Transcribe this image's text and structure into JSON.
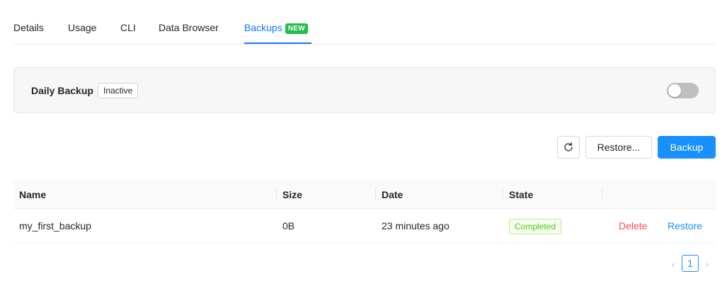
{
  "tabs": [
    {
      "label": "Details"
    },
    {
      "label": "Usage"
    },
    {
      "label": "CLI"
    },
    {
      "label": "Data Browser"
    },
    {
      "label": "Backups",
      "badge": "NEW",
      "active": true
    }
  ],
  "daily_backup": {
    "label": "Daily Backup",
    "status": "Inactive",
    "enabled": false
  },
  "toolbar": {
    "refresh_icon": "refresh-icon",
    "restore_label": "Restore...",
    "backup_label": "Backup"
  },
  "table": {
    "columns": [
      "Name",
      "Size",
      "Date",
      "State",
      ""
    ],
    "rows": [
      {
        "name": "my_first_backup",
        "size": "0B",
        "date": "23 minutes ago",
        "state": "Completed",
        "delete_label": "Delete",
        "restore_label": "Restore"
      }
    ]
  },
  "pagination": {
    "current_page": "1",
    "prev_icon": "chevron-left-icon",
    "next_icon": "chevron-right-icon"
  },
  "colors": {
    "accent": "#1890ff",
    "new_badge": "#1fbf4a",
    "success": "#52c41a",
    "danger": "#ff4d4f"
  }
}
